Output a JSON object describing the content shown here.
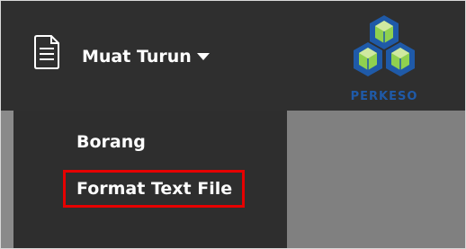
{
  "header": {
    "menu_label": "Muat Turun",
    "menu_icon": "document-icon",
    "caret_icon": "caret-down-icon"
  },
  "logo": {
    "text": "PERKESO",
    "primary_color": "#1f5aa8",
    "secondary_color": "#8fd14f"
  },
  "dropdown": {
    "items": [
      {
        "label": "Borang"
      },
      {
        "label": "Format Text File",
        "highlighted": true
      }
    ],
    "highlight_color": "#e60000"
  },
  "theme": {
    "background": "#2e2e2e",
    "text": "#ffffff",
    "panel_gray": "#808080"
  }
}
